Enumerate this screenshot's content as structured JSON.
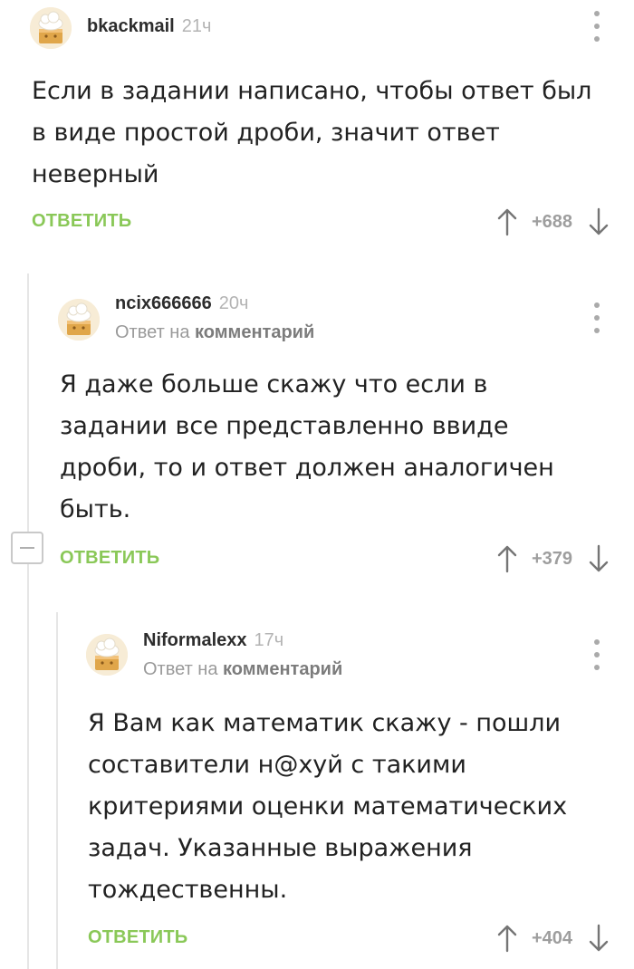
{
  "comments": [
    {
      "username": "bkackmail",
      "time": "21ч",
      "text": "Если в задании написано, чтобы ответ был в виде простой дроби, значит ответ неверный",
      "reply_label": "ОТВЕТИТЬ",
      "rating": "+688"
    },
    {
      "username": "ncix666666",
      "time": "20ч",
      "reply_prefix": "Ответ на",
      "reply_target": "комментарий",
      "text": "Я даже больше скажу что если в задании все представленно ввиде дроби, то и ответ должен аналогичен быть.",
      "reply_label": "ОТВЕТИТЬ",
      "rating": "+379"
    },
    {
      "username": "Niformalexx",
      "time": "17ч",
      "reply_prefix": "Ответ на",
      "reply_target": "комментарий",
      "text": "Я Вам как математик скажу - пошли составители  н@хуй с такими критериями оценки математических задач. Указанные выражения тождественны.",
      "reply_label": "ОТВЕТИТЬ",
      "rating": "+404"
    }
  ],
  "icons": {
    "avatar": "default-chef-avatar-icon",
    "menu": "more-vertical-icon",
    "upvote": "arrow-up-icon",
    "downvote": "arrow-down-icon",
    "collapse": "collapse-thread-icon"
  },
  "colors": {
    "reply_green": "#8ac858",
    "rating_gray": "#9e9e9e",
    "thread_line": "#e6e6e6"
  }
}
